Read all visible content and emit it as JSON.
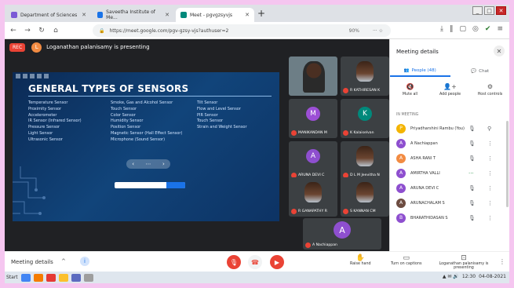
{
  "browser": {
    "tabs": [
      {
        "label": "Department of Sciences",
        "color": "#7b5bd6"
      },
      {
        "label": "Saveetha Institute of Me...",
        "color": "#1a73e8"
      },
      {
        "label": "Meet - pgvgzsyvjs",
        "color": "#00897b"
      }
    ],
    "new_tab": "+",
    "url": "https://meet.google.com/pgv-gzsy-vjs?authuser=2",
    "zoom": "90%",
    "controls": {
      "min": "_",
      "max": "□",
      "close": "✕"
    }
  },
  "meet": {
    "rec_label": "REC",
    "presenter_initial": "L",
    "presenting_text": "Loganathan palanisamy is presenting",
    "slide": {
      "title": "GENERAL TYPES OF SENSORS",
      "columns": [
        [
          "Temperature Sensor",
          "Proximity Sensor",
          "Accelerometer",
          "IR Sensor (Infrared Sensor)",
          "Pressure Sensor",
          "Light Sensor",
          "Ultrasonic Sensor"
        ],
        [
          "Smoke, Gas and Alcohol Sensor",
          "Touch Sensor",
          "Color Sensor",
          "Humidity Sensor",
          "Position Sensor",
          "Magnetic Sensor (Hall Effect Sensor)",
          "Microphone (Sound Sensor)"
        ],
        [
          "Tilt Sensor",
          "Flow and Level Sensor",
          "PIR Sensor",
          "Touch Sensor",
          "Strain and Weight Sensor"
        ]
      ]
    },
    "tiles": [
      {
        "name": "",
        "type": "video"
      },
      {
        "name": "R KATHIRESAN K",
        "type": "photo"
      },
      {
        "name": "MANIKANDAN M",
        "initial": "M",
        "color": "#9c4fd6"
      },
      {
        "name": "K Kalaiselvan",
        "initial": "K",
        "color": "#00897b"
      },
      {
        "name": "ARUNA DEVI C",
        "initial": "A",
        "color": "#8e4fcf"
      },
      {
        "name": "D L M Jeevitha N",
        "type": "photo"
      },
      {
        "name": "R GANAPATHY R",
        "type": "photo"
      },
      {
        "name": "S KANNAN CM",
        "type": "photo"
      }
    ],
    "big_tile": {
      "name": "A Nachiappan",
      "initial": "A"
    }
  },
  "bottom": {
    "meeting_details": "Meeting details",
    "caret": "^",
    "info": "i",
    "items": [
      {
        "icon": "✋",
        "label": "Raise hand"
      },
      {
        "icon": "▭",
        "label": "Turn on captions"
      },
      {
        "icon": "⊡",
        "label": "Loganathan palanisamy is presenting"
      }
    ],
    "more": "⋮"
  },
  "taskbar": {
    "start": "Start",
    "clock": "12:30",
    "date": "04-08-2021"
  },
  "panel": {
    "title": "Meeting details",
    "close": "✕",
    "tabs": [
      {
        "label": "People (48)",
        "icon": "👥"
      },
      {
        "label": "Chat",
        "icon": "💬"
      }
    ],
    "actions": [
      {
        "label": "Mute all",
        "icon": "🔇"
      },
      {
        "label": "Add people",
        "icon": "👤+"
      },
      {
        "label": "Host controls",
        "icon": "⚙"
      }
    ],
    "in_meeting": "IN MEETING",
    "participants": [
      {
        "name": "Priyadharshini Rambu (You)",
        "initial": "P",
        "color": "#f4b400",
        "photo": true
      },
      {
        "name": "A Nachiappan",
        "initial": "A",
        "color": "#8e4fcf"
      },
      {
        "name": "ASHA RANI T",
        "initial": "A",
        "color": "#f28b42"
      },
      {
        "name": "AMIRTHA VALLI",
        "initial": "A",
        "color": "#8e4fcf"
      },
      {
        "name": "ARUNA DEVI C",
        "initial": "A",
        "color": "#8e4fcf"
      },
      {
        "name": "ARUNACHALAM S",
        "initial": "A",
        "color": "#6d4c41",
        "photo": true
      },
      {
        "name": "BHARATHIDASAN S",
        "initial": "B",
        "color": "#8e4fcf"
      }
    ]
  }
}
